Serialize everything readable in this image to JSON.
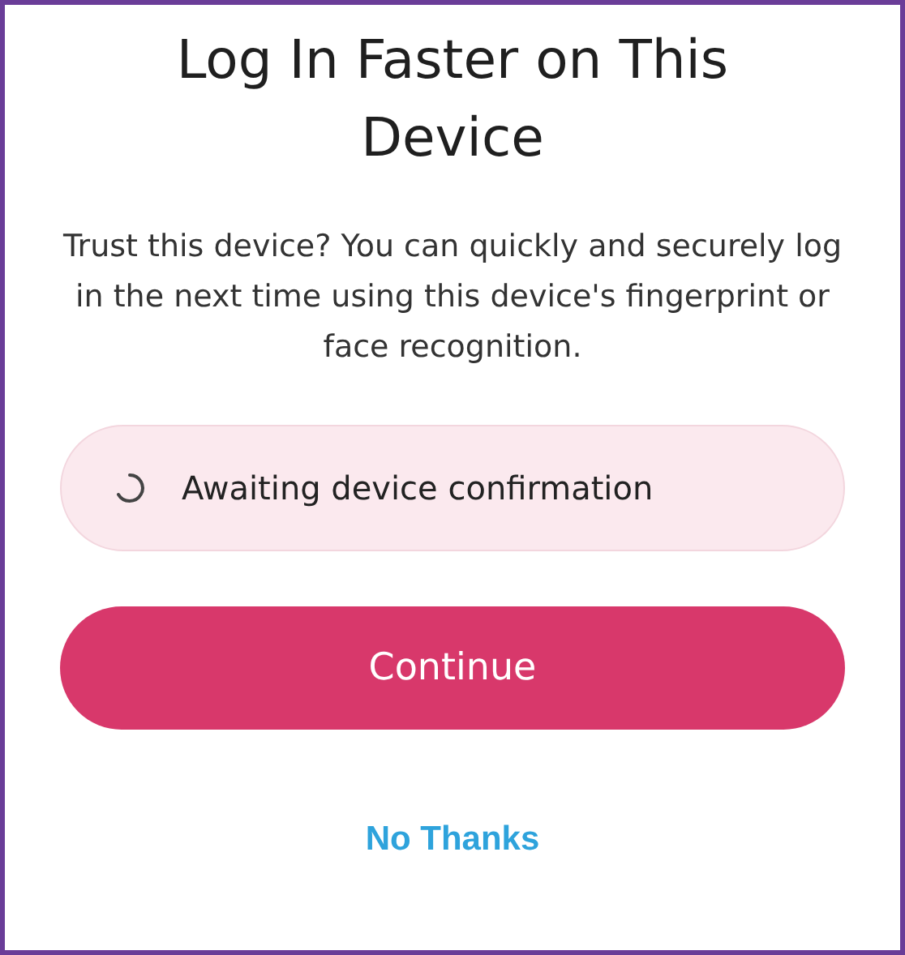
{
  "title": "Log In Faster on This Device",
  "description": "Trust this device? You can quickly and securely log in the next time using this device's fingerprint or face recognition.",
  "status": {
    "label": "Awaiting device confirmation"
  },
  "buttons": [
    {
      "kind": "primary",
      "label": "Continue"
    },
    {
      "kind": "link",
      "label": "No Thanks"
    }
  ]
}
